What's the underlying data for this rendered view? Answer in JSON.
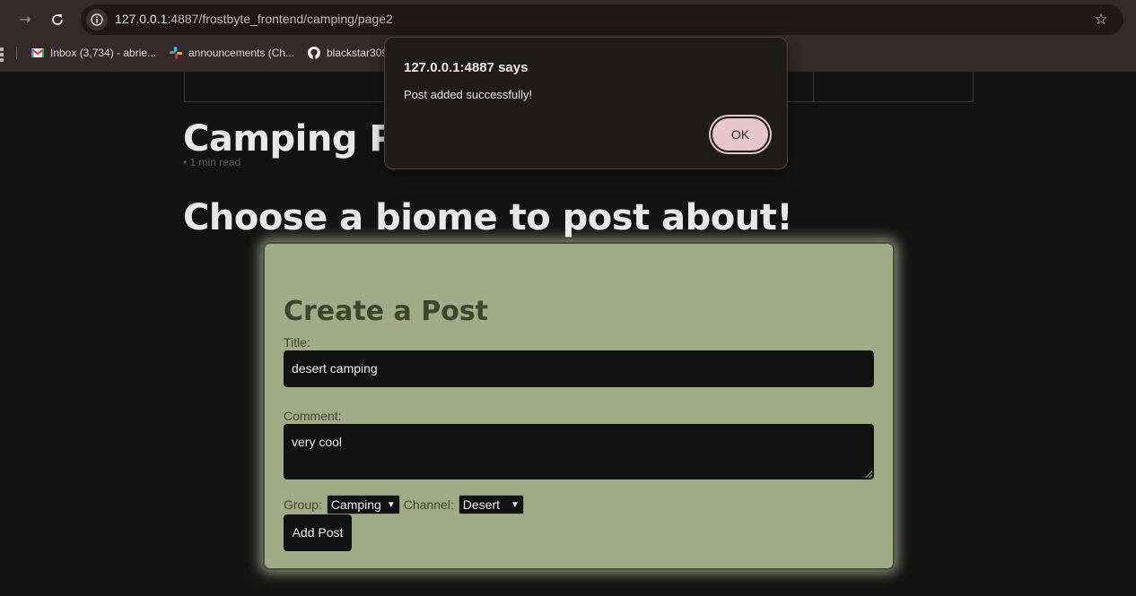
{
  "browser": {
    "url_host": "127.0.0.1",
    "url_rest": ":4887/frostbyte_frontend/camping/page2",
    "bookmarks": [
      {
        "label": "Inbox (3,734) - abrie..."
      },
      {
        "label": "announcements (Ch..."
      },
      {
        "label": "blackstar309"
      }
    ]
  },
  "page": {
    "post_title": "Camping Post",
    "read_time": "• 1 min read",
    "biome_heading": "Choose a biome to post about!"
  },
  "form": {
    "heading": "Create a Post",
    "title_label": "Title:",
    "title_value": "desert camping",
    "comment_label": "Comment:",
    "comment_value": "very cool",
    "group_label": "Group:",
    "group_value": "Camping",
    "channel_label": "Channel:",
    "channel_value": "Desert",
    "submit_label": "Add Post"
  },
  "dialog": {
    "title": "127.0.0.1:4887 says",
    "message": "Post added successfully!",
    "ok_label": "OK"
  },
  "colors": {
    "form_background": "#a2ab86",
    "form_border": "#3f533c",
    "ok_button": "#e5c7cd",
    "page_background": "#131313"
  }
}
